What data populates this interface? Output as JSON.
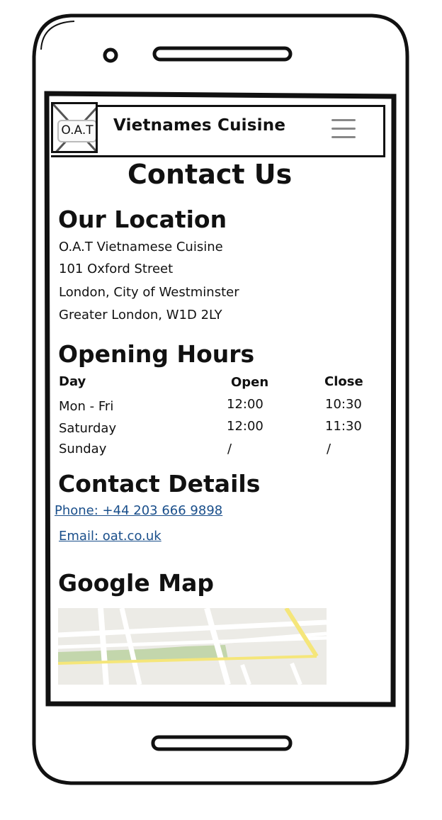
{
  "header": {
    "logo_text": "O.A.T",
    "brand": "Vietnames Cuisine"
  },
  "page_title": "Contact Us",
  "location": {
    "title": "Our Location",
    "lines": [
      "O.A.T Vietnamese Cuisine",
      "101 Oxford Street",
      "London, City of Westminster",
      "Greater London, W1D 2LY"
    ]
  },
  "hours": {
    "title": "Opening Hours",
    "headers": [
      "Day",
      "Open",
      "Close"
    ],
    "rows": [
      [
        "Mon - Fri",
        "12:00",
        "10:30"
      ],
      [
        "Saturday",
        "12:00",
        "11:30"
      ],
      [
        "Sunday",
        "/",
        "/"
      ]
    ]
  },
  "contact": {
    "title": "Contact Details",
    "phone": "Phone: +44 203 666 9898",
    "email": "Email: oat.co.uk"
  },
  "map": {
    "title": "Google Map",
    "colors": {
      "background": "#ecebe6",
      "road": "#ffffff",
      "highlight_road": "#f5e67a",
      "park": "#c3d6ac"
    }
  },
  "colors": {
    "link": "#1a4f8b",
    "frame": "#111111",
    "menu_icon": "#888888"
  }
}
